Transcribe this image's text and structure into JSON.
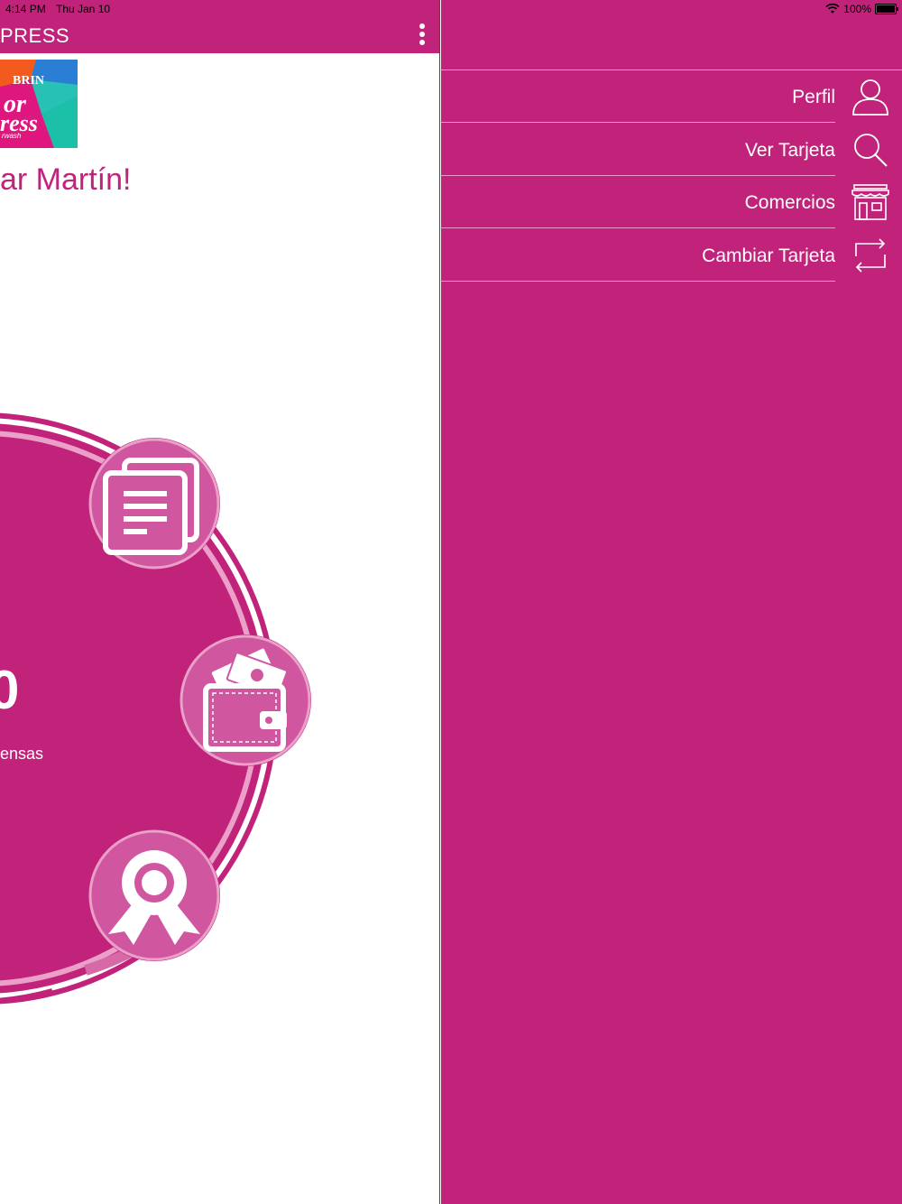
{
  "status_bar": {
    "time": "4:14 PM",
    "date": "Thu Jan 10",
    "battery": "100%"
  },
  "header": {
    "title": "PRESS"
  },
  "logo": {
    "line1": "BRIN",
    "line2": "or",
    "line3": "ress",
    "line4": "rwash"
  },
  "greeting": "ar Martín!",
  "dial": {
    "points_value": "0",
    "points_label": "ensas"
  },
  "drawer": {
    "items": [
      {
        "label": "Perfil",
        "icon": "user-icon"
      },
      {
        "label": "Ver Tarjeta",
        "icon": "search-icon"
      },
      {
        "label": "Comercios",
        "icon": "store-icon"
      },
      {
        "label": "Cambiar Tarjeta",
        "icon": "switch-icon"
      }
    ]
  },
  "colors": {
    "brand": "#c1237a",
    "divider": "#ea9cc6",
    "white": "#ffffff"
  }
}
